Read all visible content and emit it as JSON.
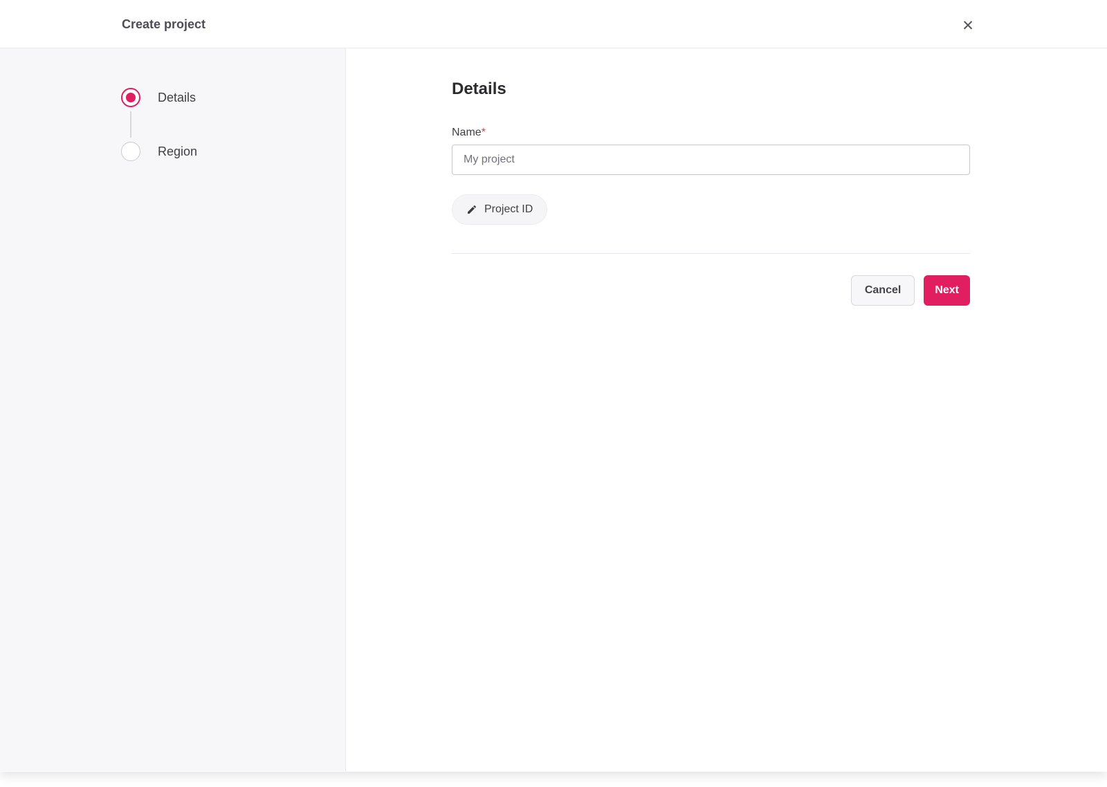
{
  "header": {
    "title": "Create project",
    "close_icon": "✕"
  },
  "stepper": {
    "steps": [
      {
        "label": "Details",
        "state": "active"
      },
      {
        "label": "Region",
        "state": "inactive"
      }
    ]
  },
  "content": {
    "heading": "Details",
    "name_field": {
      "label": "Name",
      "required_marker": "*",
      "placeholder": "My project",
      "value": ""
    },
    "project_id_button": {
      "label": "Project ID",
      "icon": "pencil-icon"
    },
    "actions": {
      "cancel_label": "Cancel",
      "next_label": "Next"
    }
  },
  "colors": {
    "accent": "#e11e60",
    "required_marker": "#e5364d",
    "sidebar_background": "#f7f7f9"
  }
}
